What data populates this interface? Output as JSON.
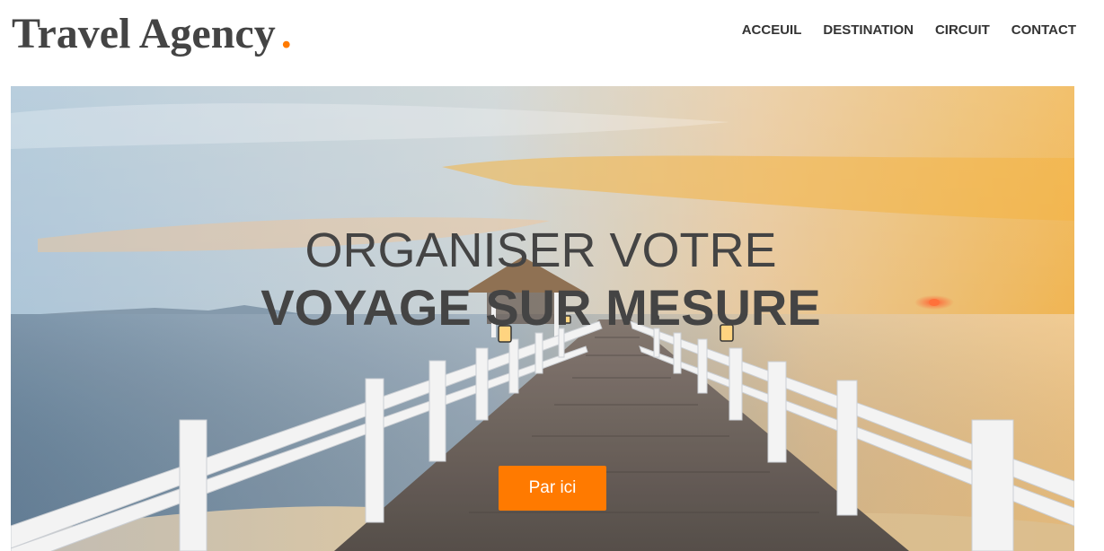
{
  "header": {
    "logo_text": "Travel Agency",
    "logo_dot": ".",
    "nav": [
      {
        "label": "ACCEUIL"
      },
      {
        "label": "DESTINATION"
      },
      {
        "label": "CIRCUIT"
      },
      {
        "label": "CONTACT"
      }
    ]
  },
  "hero": {
    "image_description": "",
    "headline_line1": "ORGANISER VOTRE",
    "headline_line2": "VOYAGE SUR MESURE",
    "cta_label": "Par ici"
  },
  "colors": {
    "accent": "#ff7a00",
    "text": "#444444",
    "nav_text": "#333333"
  }
}
